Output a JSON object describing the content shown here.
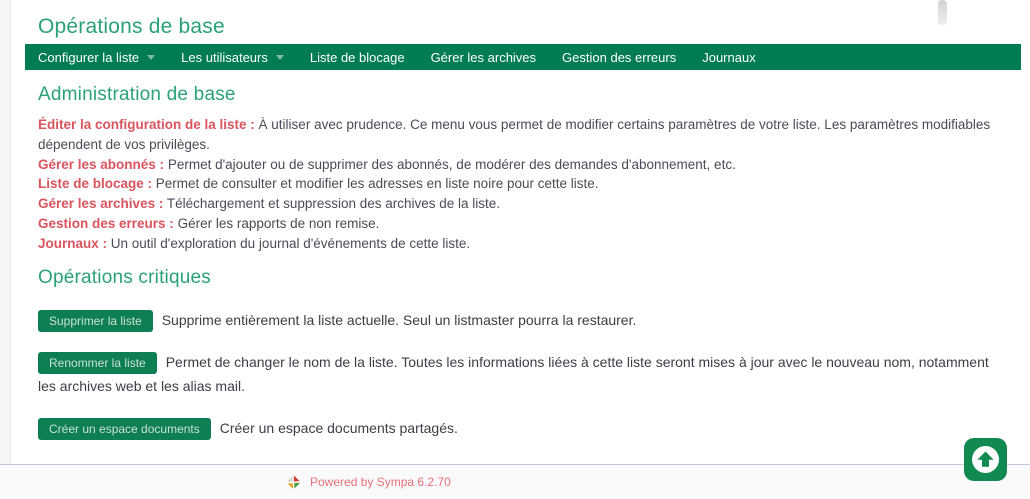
{
  "page": {
    "title": "Opérations de base"
  },
  "nav": {
    "items": [
      {
        "label": "Configurer la liste",
        "has_dropdown": true
      },
      {
        "label": "Les utilisateurs",
        "has_dropdown": true
      },
      {
        "label": "Liste de blocage",
        "has_dropdown": false
      },
      {
        "label": "Gérer les archives",
        "has_dropdown": false
      },
      {
        "label": "Gestion des erreurs",
        "has_dropdown": false
      },
      {
        "label": "Journaux",
        "has_dropdown": false
      }
    ]
  },
  "admin_section": {
    "heading": "Administration de base",
    "items": [
      {
        "label": "Éditer la configuration de la liste :",
        "description": " À utiliser avec prudence. Ce menu vous permet de modifier certains paramètres de votre liste. Les paramètres modifiables dépendent de vos privilèges."
      },
      {
        "label": "Gérer les abonnés :",
        "description": " Permet d'ajouter ou de supprimer des abonnés, de modérer des demandes d'abonnement, etc."
      },
      {
        "label": "Liste de blocage :",
        "description": " Permet de consulter et modifier les adresses en liste noire pour cette liste."
      },
      {
        "label": "Gérer les archives :",
        "description": " Téléchargement et suppression des archives de la liste."
      },
      {
        "label": "Gestion des erreurs :",
        "description": " Gérer les rapports de non remise."
      },
      {
        "label": "Journaux :",
        "description": " Un outil d'exploration du journal d'événements de cette liste."
      }
    ]
  },
  "critical_section": {
    "heading": "Opérations critiques",
    "actions": [
      {
        "button": "Supprimer la liste",
        "description": "Supprime entièrement la liste actuelle. Seul un listmaster pourra la restaurer."
      },
      {
        "button": "Renommer la liste",
        "description": "Permet de changer le nom de la liste. Toutes les informations liées à cette liste seront mises à jour avec le nouveau nom, notamment les archives web et les alias mail."
      },
      {
        "button": "Créer un espace documents",
        "description": "Créer un espace documents partagés."
      }
    ]
  },
  "footer": {
    "powered_by": "Powered by Sympa 6.2.70"
  },
  "icons": {
    "back_to_top": "arrow-up-icon",
    "brand": "sympa-pinwheel-logo",
    "nav_dropdown": "chevron-down-icon"
  },
  "colors": {
    "nav_green": "#007c53",
    "heading_green": "#2aa17a",
    "button_green": "#0e7e53",
    "back_to_top_green": "#118a51",
    "link_red": "#d9545e",
    "footer_link": "#e8707a",
    "body_text": "#4b4b57",
    "footer_border": "#bccadb"
  }
}
